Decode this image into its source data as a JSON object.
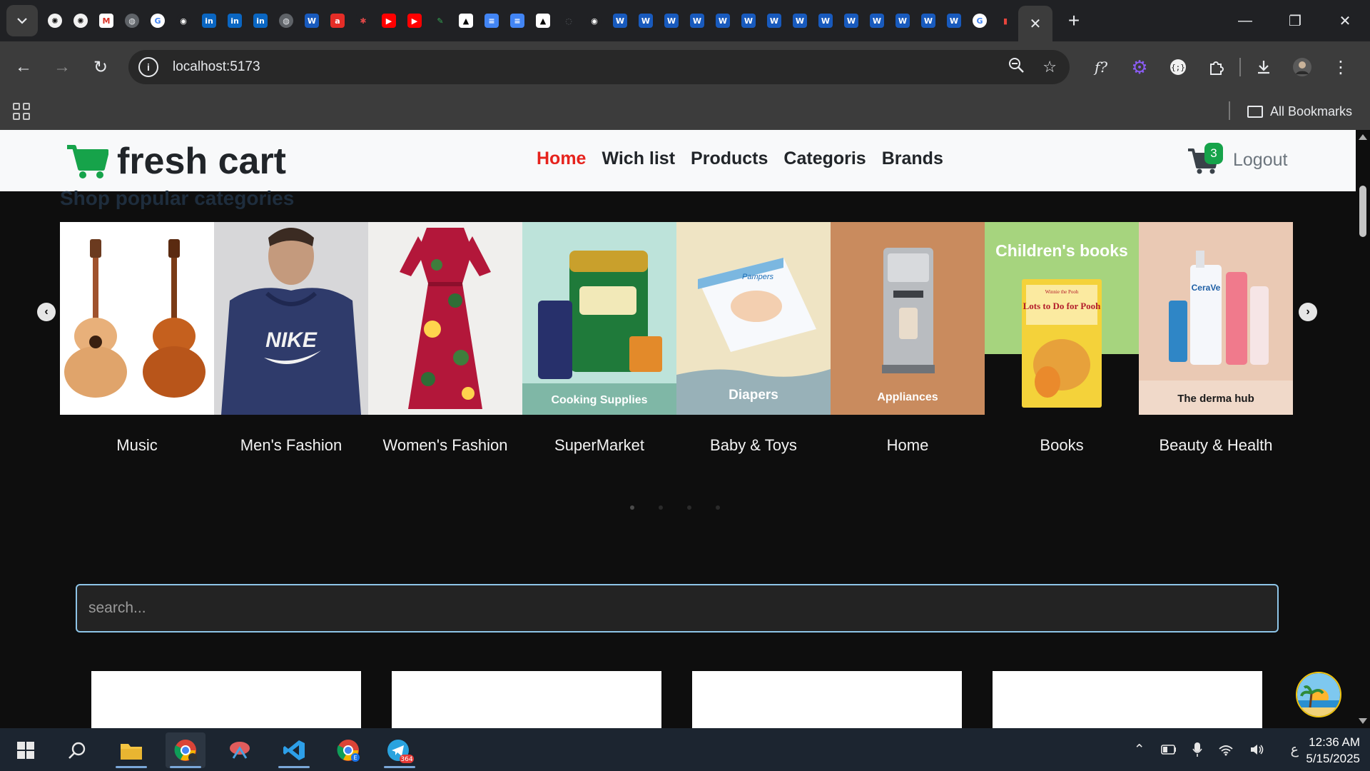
{
  "browser": {
    "url": "localhost:5173",
    "all_bookmarks_label": "All Bookmarks",
    "favicons": [
      "openai",
      "openai",
      "gmail",
      "globe",
      "google",
      "github",
      "linkedin",
      "linkedin",
      "linkedin",
      "globe",
      "word",
      "red-app",
      "octopus",
      "youtube",
      "youtube",
      "pen",
      "triangle",
      "docs",
      "docs",
      "triangle",
      "spinner",
      "github",
      "word",
      "word",
      "word",
      "word",
      "word",
      "word",
      "word",
      "word",
      "word",
      "word",
      "word",
      "word",
      "word",
      "word",
      "google",
      "chart"
    ]
  },
  "navbar": {
    "logo_text": "fresh cart",
    "links": [
      "Home",
      "Wich list",
      "Products",
      "Categoris",
      "Brands"
    ],
    "cart_count": "3",
    "logout_label": "Logout"
  },
  "categories": {
    "title": "Shop popular categories",
    "items": [
      {
        "label": "Music",
        "image_caption": ""
      },
      {
        "label": "Men's Fashion",
        "image_caption": ""
      },
      {
        "label": "Women's Fashion",
        "image_caption": ""
      },
      {
        "label": "SuperMarket",
        "image_caption": "Cooking Supplies"
      },
      {
        "label": "Baby & Toys",
        "image_caption": "Diapers"
      },
      {
        "label": "Home",
        "image_caption": "Appliances"
      },
      {
        "label": "Books",
        "image_caption": "Children's books"
      },
      {
        "label": "Beauty & Health",
        "image_caption": "The derma hub"
      }
    ],
    "image_texts": {
      "hoodie_brand": "NIKE",
      "book_title": "Lots to Do for Pooh",
      "book_series": "Winnie the Pooh",
      "diaper_pack": "Pampers",
      "beauty_brand": "CeraVe"
    },
    "prev_icon": "chevron-left-icon",
    "next_icon": "chevron-right-icon",
    "dot_count": 4
  },
  "search": {
    "placeholder": "search...",
    "value": ""
  },
  "taskbar": {
    "telegram_badge": "364",
    "chrome_badge": "E",
    "time": "12:36 AM",
    "date": "5/15/2025",
    "language": "ع"
  },
  "colors": {
    "brand_green": "#16a34a",
    "active_link": "#e6231d",
    "search_border": "#8ec5e8"
  }
}
